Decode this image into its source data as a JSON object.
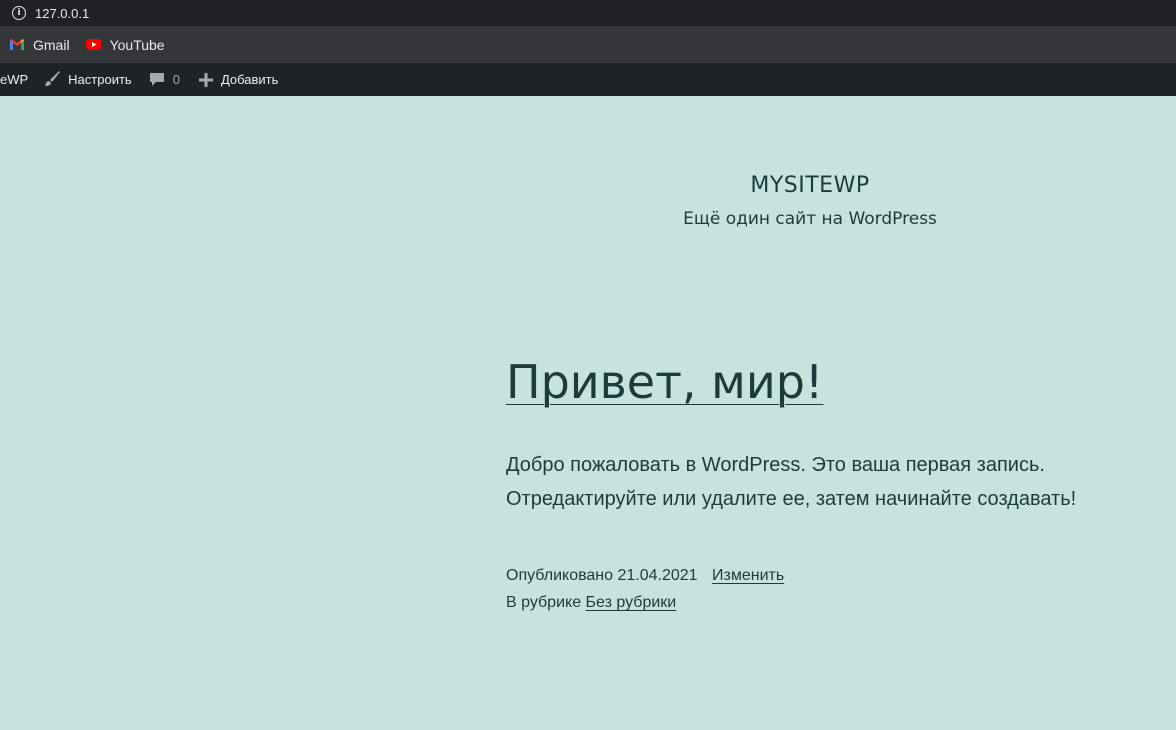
{
  "browser": {
    "url": "127.0.0.1",
    "bookmarks": [
      {
        "label": "Gmail",
        "icon": "gmail-icon"
      },
      {
        "label": "YouTube",
        "icon": "youtube-icon"
      }
    ]
  },
  "adminbar": {
    "site_fragment": "eWP",
    "customize": "Настроить",
    "comments_count": "0",
    "add_new": "Добавить"
  },
  "site": {
    "title": "MYSITEWP",
    "description": "Ещё один сайт на WordPress"
  },
  "post": {
    "title": "Привет, мир!",
    "body_line1": "Добро пожаловать в WordPress. Это ваша первая запись.",
    "body_line2": "Отредактируйте или удалите ее, затем начинайте создавать!",
    "published_label": "Опубликовано 21.04.2021",
    "edit_link": "Изменить",
    "category_label": "В рубрике",
    "category_link": "Без рубрики"
  },
  "colors": {
    "page_bg": "#c6e3dd",
    "text": "#1d3b3a",
    "adminbar_bg": "#1d2327",
    "youtube_red": "#ff0000"
  }
}
